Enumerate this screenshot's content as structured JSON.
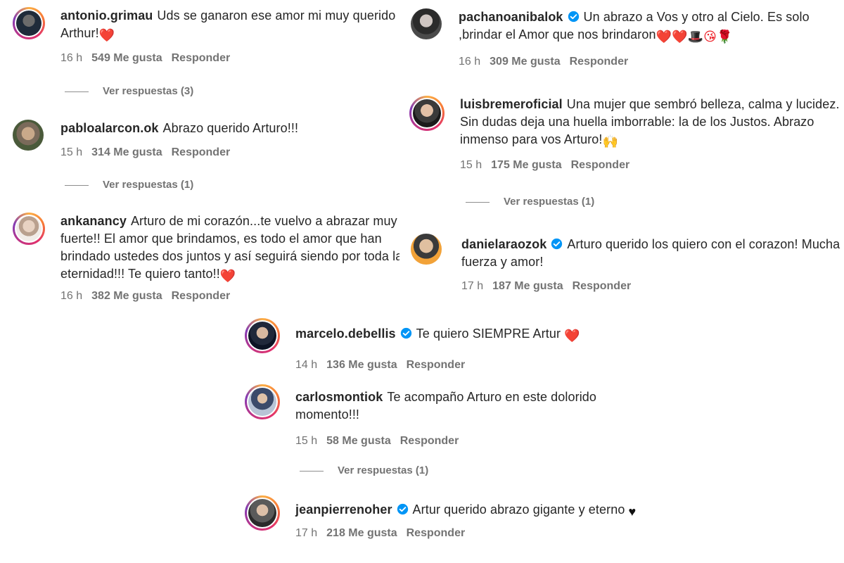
{
  "comments": [
    {
      "username": "antonio.grimau",
      "verified": false,
      "text": "Uds se ganaron ese amor mi muy querido Arthur!",
      "emoji": "❤️",
      "time": "16 h",
      "likes": "549 Me gusta",
      "reply": "Responder",
      "view_replies": "Ver respuestas (3)"
    },
    {
      "username": "pabloalarcon.ok",
      "verified": false,
      "text": "Abrazo querido Arturo!!!",
      "emoji": "",
      "time": "15 h",
      "likes": "314 Me gusta",
      "reply": "Responder",
      "view_replies": "Ver respuestas (1)"
    },
    {
      "username": "ankanancy",
      "verified": false,
      "text": "Arturo de mi corazón...te vuelvo a abrazar muy fuerte!! El amor que brindamos, es todo el amor que han brindado ustedes dos juntos y así seguirá siendo por toda la eternidad!!! Te quiero tanto!!",
      "emoji": "❤️",
      "time": "16 h",
      "likes": "382 Me gusta",
      "reply": "Responder"
    },
    {
      "username": "pachanoanibalok",
      "verified": true,
      "text": "Un abrazo a Vos y otro al Cielo. Es solo ,brindar el Amor que nos brindaron",
      "emoji": "❤️❤️🎩😘🌹",
      "time": "16 h",
      "likes": "309 Me gusta",
      "reply": "Responder"
    },
    {
      "username": "luisbremeroficial",
      "verified": false,
      "text": "Una mujer que sembró belleza, calma y lucidez. Sin dudas deja una huella imborrable: la de los Justos. Abrazo inmenso para vos Arturo!",
      "emoji": "🙌",
      "time": "15 h",
      "likes": "175 Me gusta",
      "reply": "Responder",
      "view_replies": "Ver respuestas (1)"
    },
    {
      "username": "danielaraozok",
      "verified": true,
      "text": "Arturo querido los quiero con el corazon! Mucha fuerza y amor!",
      "emoji": "",
      "time": "17 h",
      "likes": "187 Me gusta",
      "reply": "Responder"
    },
    {
      "username": "marcelo.debellis",
      "verified": true,
      "text": "Te quiero SIEMPRE Artur",
      "emoji": "❤️",
      "time": "14 h",
      "likes": "136 Me gusta",
      "reply": "Responder"
    },
    {
      "username": "carlosmontiok",
      "verified": false,
      "text": "Te acompaño Arturo en este dolorido momento!!!",
      "emoji": "",
      "time": "15 h",
      "likes": "58 Me gusta",
      "reply": "Responder",
      "view_replies": "Ver respuestas (1)"
    },
    {
      "username": "jeanpierrenoher",
      "verified": true,
      "text": "Artur querido abrazo gigante y eterno",
      "emoji": "♥",
      "time": "17 h",
      "likes": "218 Me gusta",
      "reply": "Responder"
    }
  ],
  "colors": {
    "verified": "#0095f6",
    "heart": "#ed1c24",
    "text": "#262626",
    "muted": "#737373"
  }
}
